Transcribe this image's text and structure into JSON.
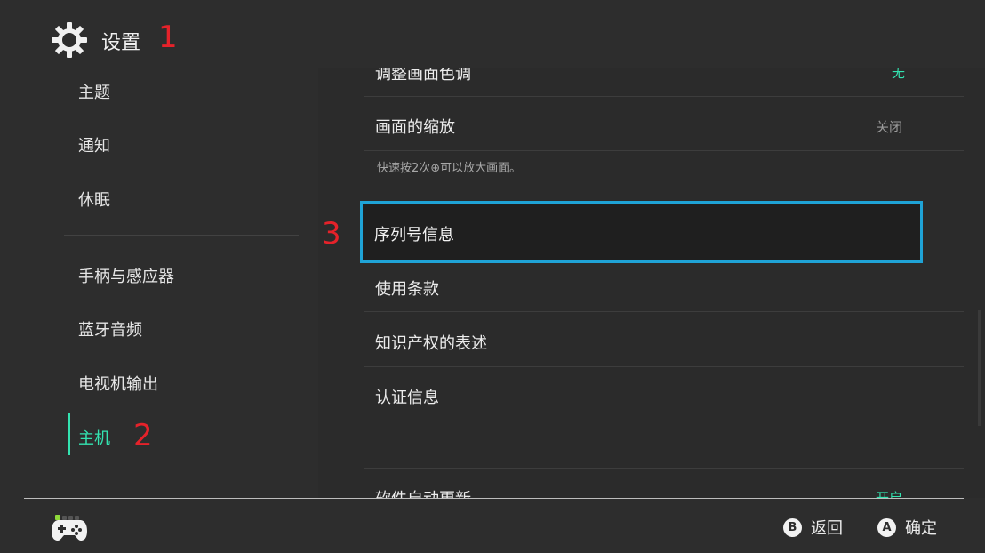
{
  "header": {
    "title": "设置"
  },
  "annotations": {
    "a1": "1",
    "a2": "2",
    "a3": "3"
  },
  "sidebar": {
    "items": [
      {
        "label": "主题"
      },
      {
        "label": "通知"
      },
      {
        "label": "休眠"
      },
      {
        "label": "手柄与感应器"
      },
      {
        "label": "蓝牙音频"
      },
      {
        "label": "电视机输出"
      },
      {
        "label": "主机",
        "active": true
      }
    ]
  },
  "content": {
    "top_cut_label": "调整画面色调",
    "top_cut_value": "无",
    "zoom_label": "画面的缩放",
    "zoom_value": "关闭",
    "zoom_desc": "快速按2次⊕可以放大画面。",
    "serial_label": "序列号信息",
    "terms_label": "使用条款",
    "ip_label": "知识产权的表述",
    "cert_label": "认证信息",
    "bottom_cut_label": "软件自动更新",
    "bottom_cut_value": "开启"
  },
  "footer": {
    "back_key": "B",
    "back_label": "返回",
    "ok_key": "A",
    "ok_label": "确定"
  },
  "colors": {
    "accent": "#33e3b0",
    "focus": "#1fa3d6",
    "annotation": "#e5222a",
    "background": "#2d2d2d"
  },
  "icons": [
    "gear-icon",
    "controller-icon"
  ]
}
